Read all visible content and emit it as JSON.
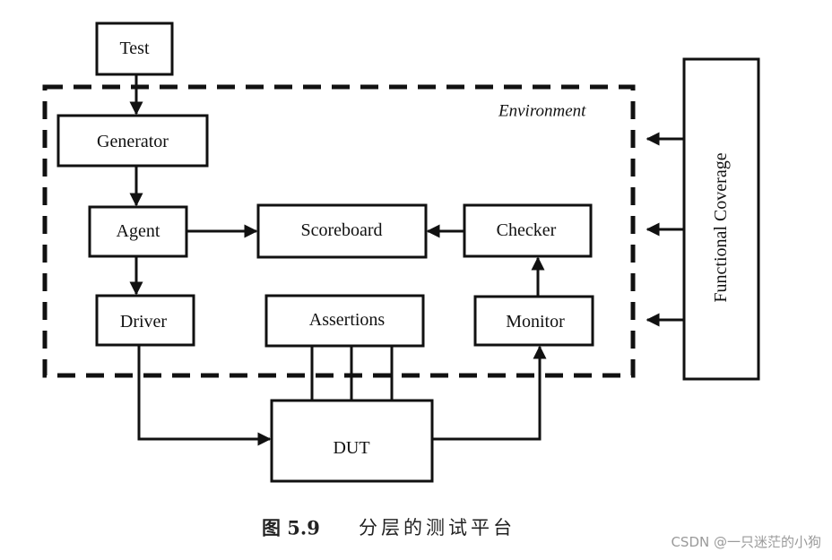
{
  "diagram": {
    "environment_label": "Environment",
    "nodes": {
      "test": "Test",
      "generator": "Generator",
      "agent": "Agent",
      "scoreboard": "Scoreboard",
      "checker": "Checker",
      "driver": "Driver",
      "assertions": "Assertions",
      "monitor": "Monitor",
      "dut": "DUT",
      "functional_coverage": "Functional Coverage"
    },
    "edges": [
      {
        "from": "Test",
        "to": "Generator"
      },
      {
        "from": "Generator",
        "to": "Agent"
      },
      {
        "from": "Agent",
        "to": "Scoreboard"
      },
      {
        "from": "Agent",
        "to": "Driver"
      },
      {
        "from": "Checker",
        "to": "Scoreboard"
      },
      {
        "from": "Monitor",
        "to": "Checker"
      },
      {
        "from": "Driver",
        "to": "DUT"
      },
      {
        "from": "Assertions",
        "to": "DUT",
        "count": 3
      },
      {
        "from": "DUT",
        "to": "Monitor"
      },
      {
        "from": "Functional Coverage",
        "to": "Environment",
        "count": 3
      }
    ]
  },
  "caption": {
    "figure_number": "图 5.9",
    "title": "分层的测试平台"
  },
  "watermark": "CSDN @一只迷茫的小狗"
}
